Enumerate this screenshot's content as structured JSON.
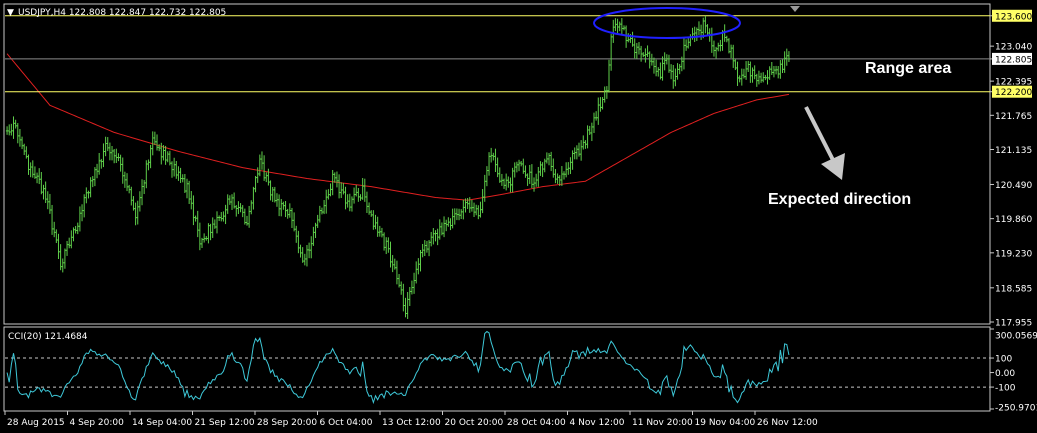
{
  "colors": {
    "background": "#000000",
    "frame": "#c8c8c8",
    "bars": "#5fcf4a",
    "moving_average": "#e02020",
    "level_line": "#ffff66",
    "level_box_text": "#000000",
    "current_price_line": "#8a8a8a",
    "cci": "#3ec8d8",
    "oval": "#2020ff",
    "arrow": "#c8c8c8",
    "text": "#ffffff"
  },
  "chart_data": [
    {
      "type": "ohlc",
      "symbol_info": {
        "triangle": "▼",
        "text": "USDJPY,H4  122.808 122.847 122.732 122.805"
      },
      "y_ticks": [
        "123.600",
        "123.040",
        "122.805",
        "122.395",
        "122.200",
        "121.765",
        "121.135",
        "120.490",
        "119.860",
        "119.230",
        "118.585",
        "117.955"
      ],
      "ylim": [
        117.955,
        123.78
      ],
      "current_price": 122.805,
      "range_levels": [
        {
          "value": 123.6,
          "label": "123.600"
        },
        {
          "value": 122.2,
          "label": "122.200"
        }
      ],
      "x_tick_labels": [
        "28 Aug 2015",
        "4 Sep 20:00",
        "14 Sep 04:00",
        "21 Sep 12:00",
        "28 Sep 20:00",
        "6 Oct 04:00",
        "13 Oct 12:00",
        "20 Oct 20:00",
        "28 Oct 04:00",
        "4 Nov 12:00",
        "11 Nov 20:00",
        "19 Nov 04:00",
        "26 Nov 12:00"
      ],
      "price_path": [
        [
          0,
          121.4
        ],
        [
          4,
          121.6
        ],
        [
          10,
          120.8
        ],
        [
          18,
          120.3
        ],
        [
          25,
          119.0
        ],
        [
          32,
          119.7
        ],
        [
          40,
          120.6
        ],
        [
          46,
          121.2
        ],
        [
          52,
          121.0
        ],
        [
          60,
          119.9
        ],
        [
          68,
          121.3
        ],
        [
          76,
          120.9
        ],
        [
          84,
          120.4
        ],
        [
          90,
          119.5
        ],
        [
          96,
          119.7
        ],
        [
          104,
          120.2
        ],
        [
          112,
          119.8
        ],
        [
          118,
          120.9
        ],
        [
          126,
          120.1
        ],
        [
          132,
          119.9
        ],
        [
          138,
          119.0
        ],
        [
          144,
          119.7
        ],
        [
          152,
          120.6
        ],
        [
          160,
          120.1
        ],
        [
          166,
          120.4
        ],
        [
          172,
          119.7
        ],
        [
          178,
          119.3
        ],
        [
          186,
          118.2
        ],
        [
          192,
          119.1
        ],
        [
          200,
          119.6
        ],
        [
          208,
          119.8
        ],
        [
          214,
          120.1
        ],
        [
          220,
          119.9
        ],
        [
          226,
          121.1
        ],
        [
          232,
          120.4
        ],
        [
          240,
          120.9
        ],
        [
          246,
          120.5
        ],
        [
          252,
          121.0
        ],
        [
          258,
          120.5
        ],
        [
          264,
          121.0
        ],
        [
          270,
          121.3
        ],
        [
          276,
          121.9
        ],
        [
          280,
          122.2
        ],
        [
          282,
          123.3
        ],
        [
          286,
          123.5
        ],
        [
          292,
          123.0
        ],
        [
          298,
          122.9
        ],
        [
          304,
          122.5
        ],
        [
          308,
          122.8
        ],
        [
          312,
          122.4
        ],
        [
          316,
          123.0
        ],
        [
          322,
          123.3
        ],
        [
          326,
          123.5
        ],
        [
          330,
          122.9
        ],
        [
          334,
          123.2
        ],
        [
          338,
          122.9
        ],
        [
          342,
          122.4
        ],
        [
          346,
          122.6
        ],
        [
          350,
          122.4
        ],
        [
          354,
          122.5
        ],
        [
          360,
          122.6
        ],
        [
          364,
          122.8
        ]
      ],
      "ma_path": [
        [
          0,
          122.9
        ],
        [
          20,
          121.95
        ],
        [
          50,
          121.45
        ],
        [
          80,
          121.1
        ],
        [
          110,
          120.8
        ],
        [
          140,
          120.6
        ],
        [
          170,
          120.45
        ],
        [
          200,
          120.25
        ],
        [
          215,
          120.2
        ],
        [
          230,
          120.3
        ],
        [
          250,
          120.45
        ],
        [
          270,
          120.55
        ],
        [
          290,
          121.0
        ],
        [
          310,
          121.45
        ],
        [
          330,
          121.8
        ],
        [
          350,
          122.05
        ],
        [
          365,
          122.15
        ]
      ],
      "annotations": {
        "range": "Range area",
        "direction": "Expected direction"
      }
    },
    {
      "type": "line",
      "name": "CCI(20) 121.4684",
      "y_ticks": [
        "300.0569",
        "100",
        "0.00",
        "-100",
        "-250.9701"
      ],
      "ylim": [
        -250.9701,
        300.0569
      ],
      "dashed_levels": [
        100,
        -100
      ],
      "last_value": 121.4684
    }
  ]
}
